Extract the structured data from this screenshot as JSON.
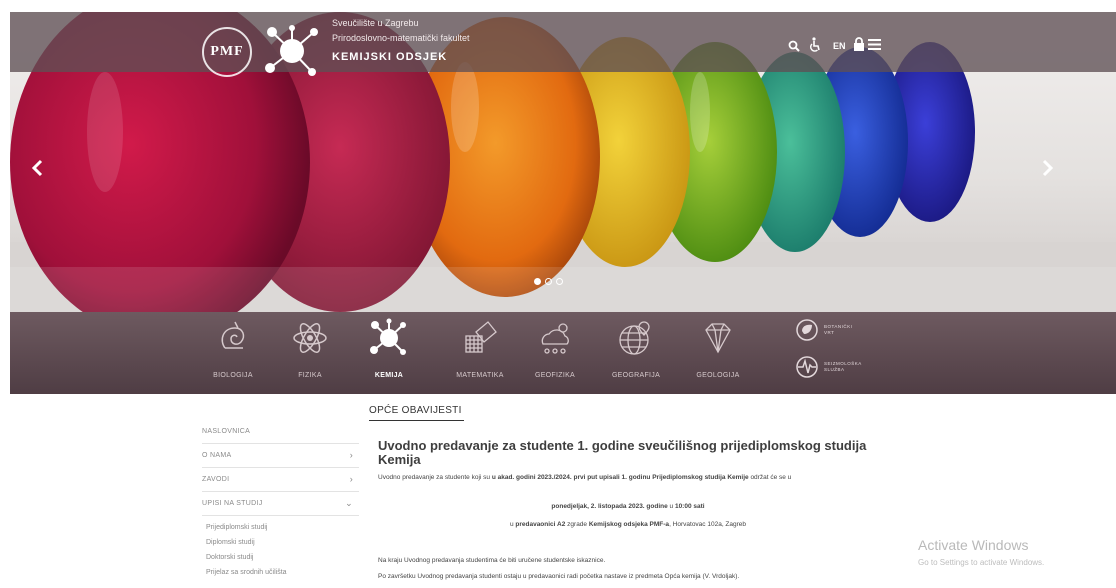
{
  "brand": {
    "pmf": "PMF",
    "university": "Sveučilište u Zagrebu",
    "faculty": "Prirodoslovno-matematički fakultet",
    "department": "KEMIJSKI ODSJEK"
  },
  "topbar": {
    "lang": "EN"
  },
  "slider": {
    "slide_count": 3,
    "active_index": 0
  },
  "nav": {
    "items": [
      {
        "label": "BIOLOGIJA",
        "icon": "shell-icon"
      },
      {
        "label": "FIZIKA",
        "icon": "atom-icon"
      },
      {
        "label": "KEMIJA",
        "icon": "molecule-icon",
        "active": true
      },
      {
        "label": "MATEMATIKA",
        "icon": "geometry-icon"
      },
      {
        "label": "GEOFIZIKA",
        "icon": "weather-icon"
      },
      {
        "label": "GEOGRAFIJA",
        "icon": "globe-pin-icon"
      },
      {
        "label": "GEOLOGIJA",
        "icon": "diamond-icon"
      }
    ],
    "side": [
      {
        "label": "BOTANIČKI VRT",
        "icon": "leaf-icon"
      },
      {
        "label": "SEIZMOLOŠKA SLUŽBA",
        "icon": "seismograph-icon"
      }
    ]
  },
  "sidebar": {
    "items": [
      {
        "label": "NASLOVNICA"
      },
      {
        "label": "O NAMA",
        "chevron": "›"
      },
      {
        "label": "ZAVODI",
        "chevron": "›"
      },
      {
        "label": "UPISI NA STUDIJ",
        "chevron": "⌄"
      }
    ],
    "subitems": [
      "Prijediplomski studij",
      "Diplomski studij",
      "Doktorski studij",
      "Prijelaz sa srodnih učilišta"
    ]
  },
  "main": {
    "section_title": "OPĆE OBAVIJESTI",
    "article_title": "Uvodno predavanje za studente 1. godine sveučilišnog prijediplomskog studija Kemija",
    "p1": {
      "a": "Uvodno predavanje za studente koji su ",
      "b": "u akad. godini 2023./2024. prvi put upisali 1. godinu Prijediplomskog studija Kemije",
      "c": " održat će se u"
    },
    "p2": {
      "a": "ponedjeljak, 2. listopada 2023. godine",
      "b": " u ",
      "c": "10:00 sati"
    },
    "p3": {
      "a": "u ",
      "b": "predavaonici A2",
      "c": " zgrade ",
      "d": "Kemijskog odsjeka PMF-a",
      "e": ", Horvatovac 102a, Zagreb"
    },
    "p4": "Na kraju Uvodnog predavanja studentima će biti uručene studentske iskaznice.",
    "p5": "Po završetku Uvodnog predavanja studenti ostaju u predavaonici radi početka nastave iz predmeta Opća kemija (V. Vrdoljak)."
  },
  "watermark": {
    "line1": "Activate Windows",
    "line2": "Go to Settings to activate Windows."
  },
  "colors": {
    "nav_bg": "#5e4a51",
    "topbar": "#5f5055",
    "text": "#444444"
  }
}
